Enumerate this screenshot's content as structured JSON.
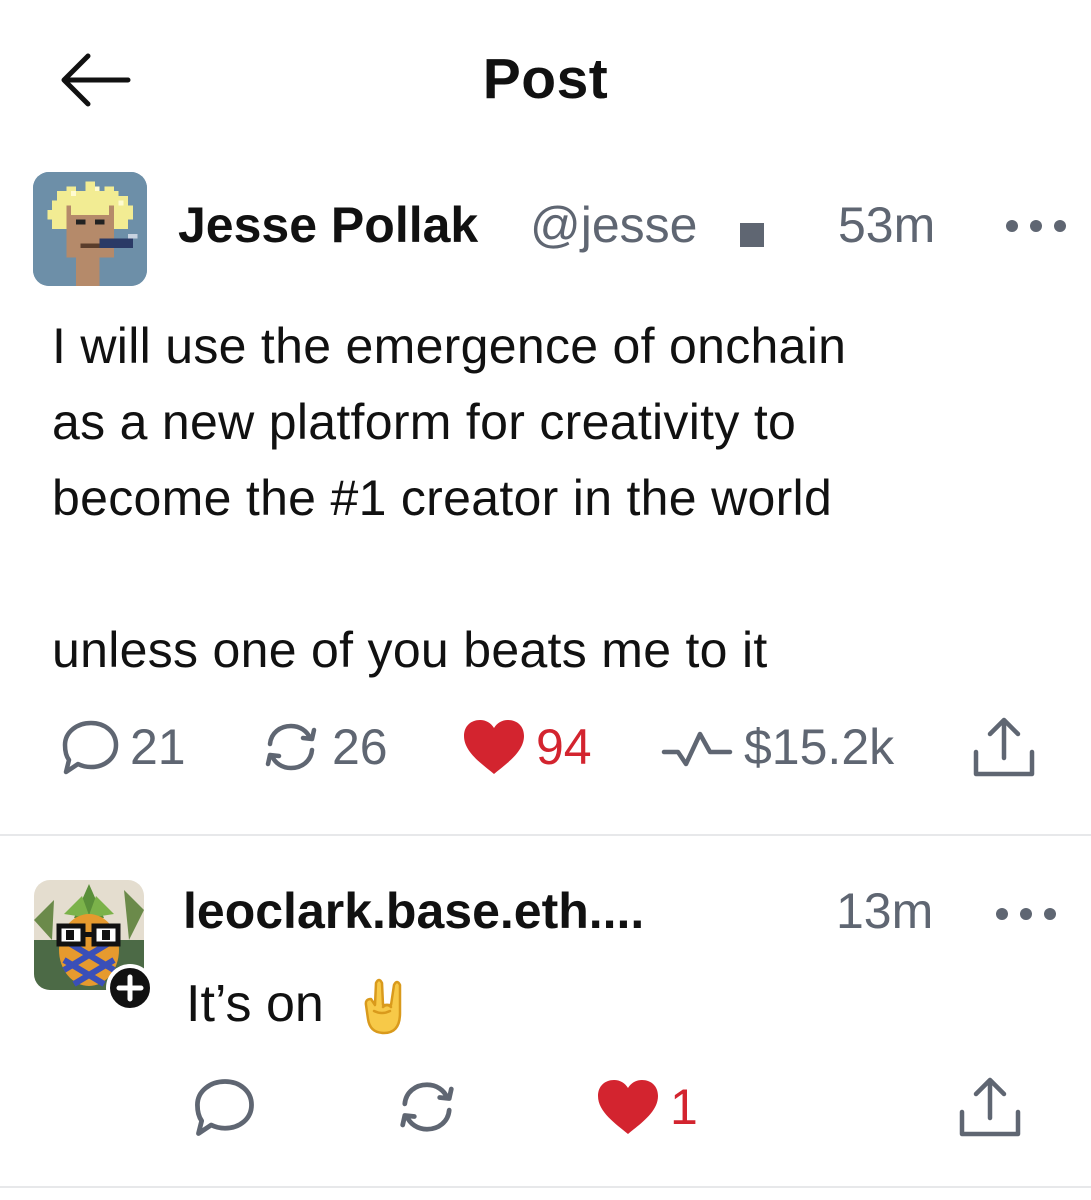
{
  "header": {
    "title": "Post",
    "back_icon": "arrow-left-icon"
  },
  "post": {
    "author_name": "Jesse Pollak",
    "handle": "@jesse",
    "time": "53m",
    "text_lines": [
      "I will use the emergence of onchain",
      "as a new platform for creativity to",
      "become the #1 creator in the world"
    ],
    "text_line_last": "unless one of you beats me to it",
    "stats": {
      "replies": "21",
      "recasts": "26",
      "likes": "94",
      "tips": "$15.2k"
    },
    "colors": {
      "like": "#d3242f",
      "muted": "#5f6672"
    }
  },
  "reply": {
    "author_name": "leoclark.base.eth....",
    "time": "13m",
    "text": "It’s on",
    "emoji": "sign-of-horns-emoji",
    "likes": "1"
  }
}
